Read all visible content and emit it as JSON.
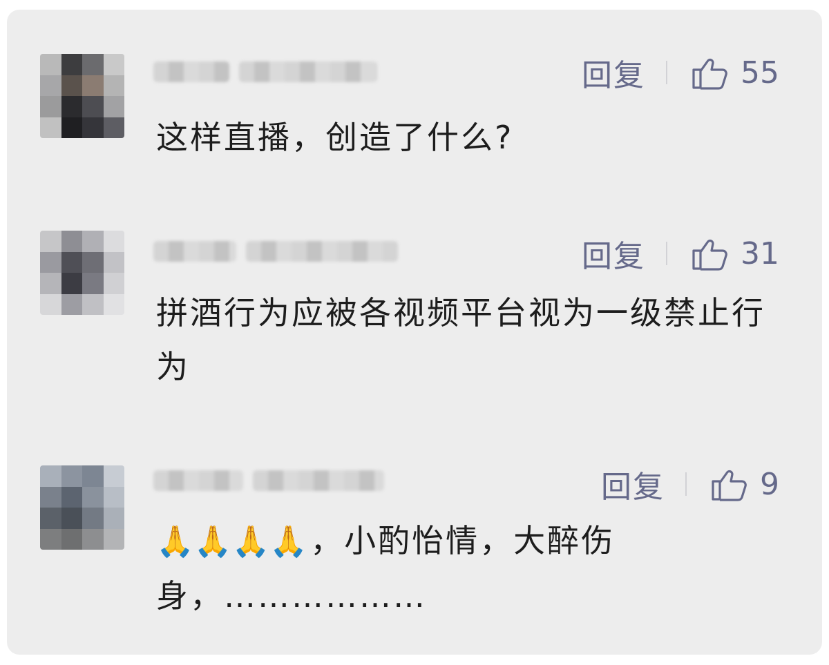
{
  "comments": [
    {
      "username": "",
      "reply_label": "回复",
      "likes": "55",
      "text": "这样直播，创造了什么?",
      "avatar_colors": [
        "#b9b9b9",
        "#3d3d3f",
        "#6b6b6e",
        "#c9c9c9",
        "#a7a7a9",
        "#5a524c",
        "#8b7c72",
        "#b4b4b4",
        "#9b9b9c",
        "#2b2b2e",
        "#4d4d52",
        "#a2a2a4",
        "#c1c1c1",
        "#1f1f22",
        "#35353a",
        "#5d5d63"
      ]
    },
    {
      "username": "",
      "reply_label": "回复",
      "likes": "31",
      "text": "拼酒行为应被各视频平台视为一级禁止行为",
      "avatar_colors": [
        "#c6c6c8",
        "#8e8e94",
        "#b0b0b5",
        "#dcdcde",
        "#9a9aa0",
        "#4f4f56",
        "#6e6e75",
        "#c2c2c6",
        "#b5b5b9",
        "#3c3c43",
        "#7a7a82",
        "#d0d0d3",
        "#d7d7d9",
        "#9d9da3",
        "#c0c0c4",
        "#e1e1e3"
      ]
    },
    {
      "username": "",
      "reply_label": "回复",
      "likes": "9",
      "text_emoji": "🙏🙏🙏🙏",
      "text": "，小酌怡情，大醉伤身，………………",
      "avatar_colors": [
        "#a9b0ba",
        "#8c94a0",
        "#7d8693",
        "#c7ccd3",
        "#7a818c",
        "#5c6470",
        "#8a929d",
        "#b8bec6",
        "#5b6169",
        "#4a5058",
        "#737a84",
        "#aab0b8",
        "#7d7e7f",
        "#6e6f70",
        "#8d8e90",
        "#b3b4b6"
      ]
    }
  ],
  "colors": {
    "card_bg": "#ededed",
    "meta_text": "#65698a",
    "body_text": "#1d1d1d"
  },
  "icons": {
    "like": "thumbs-up-outline-icon"
  }
}
